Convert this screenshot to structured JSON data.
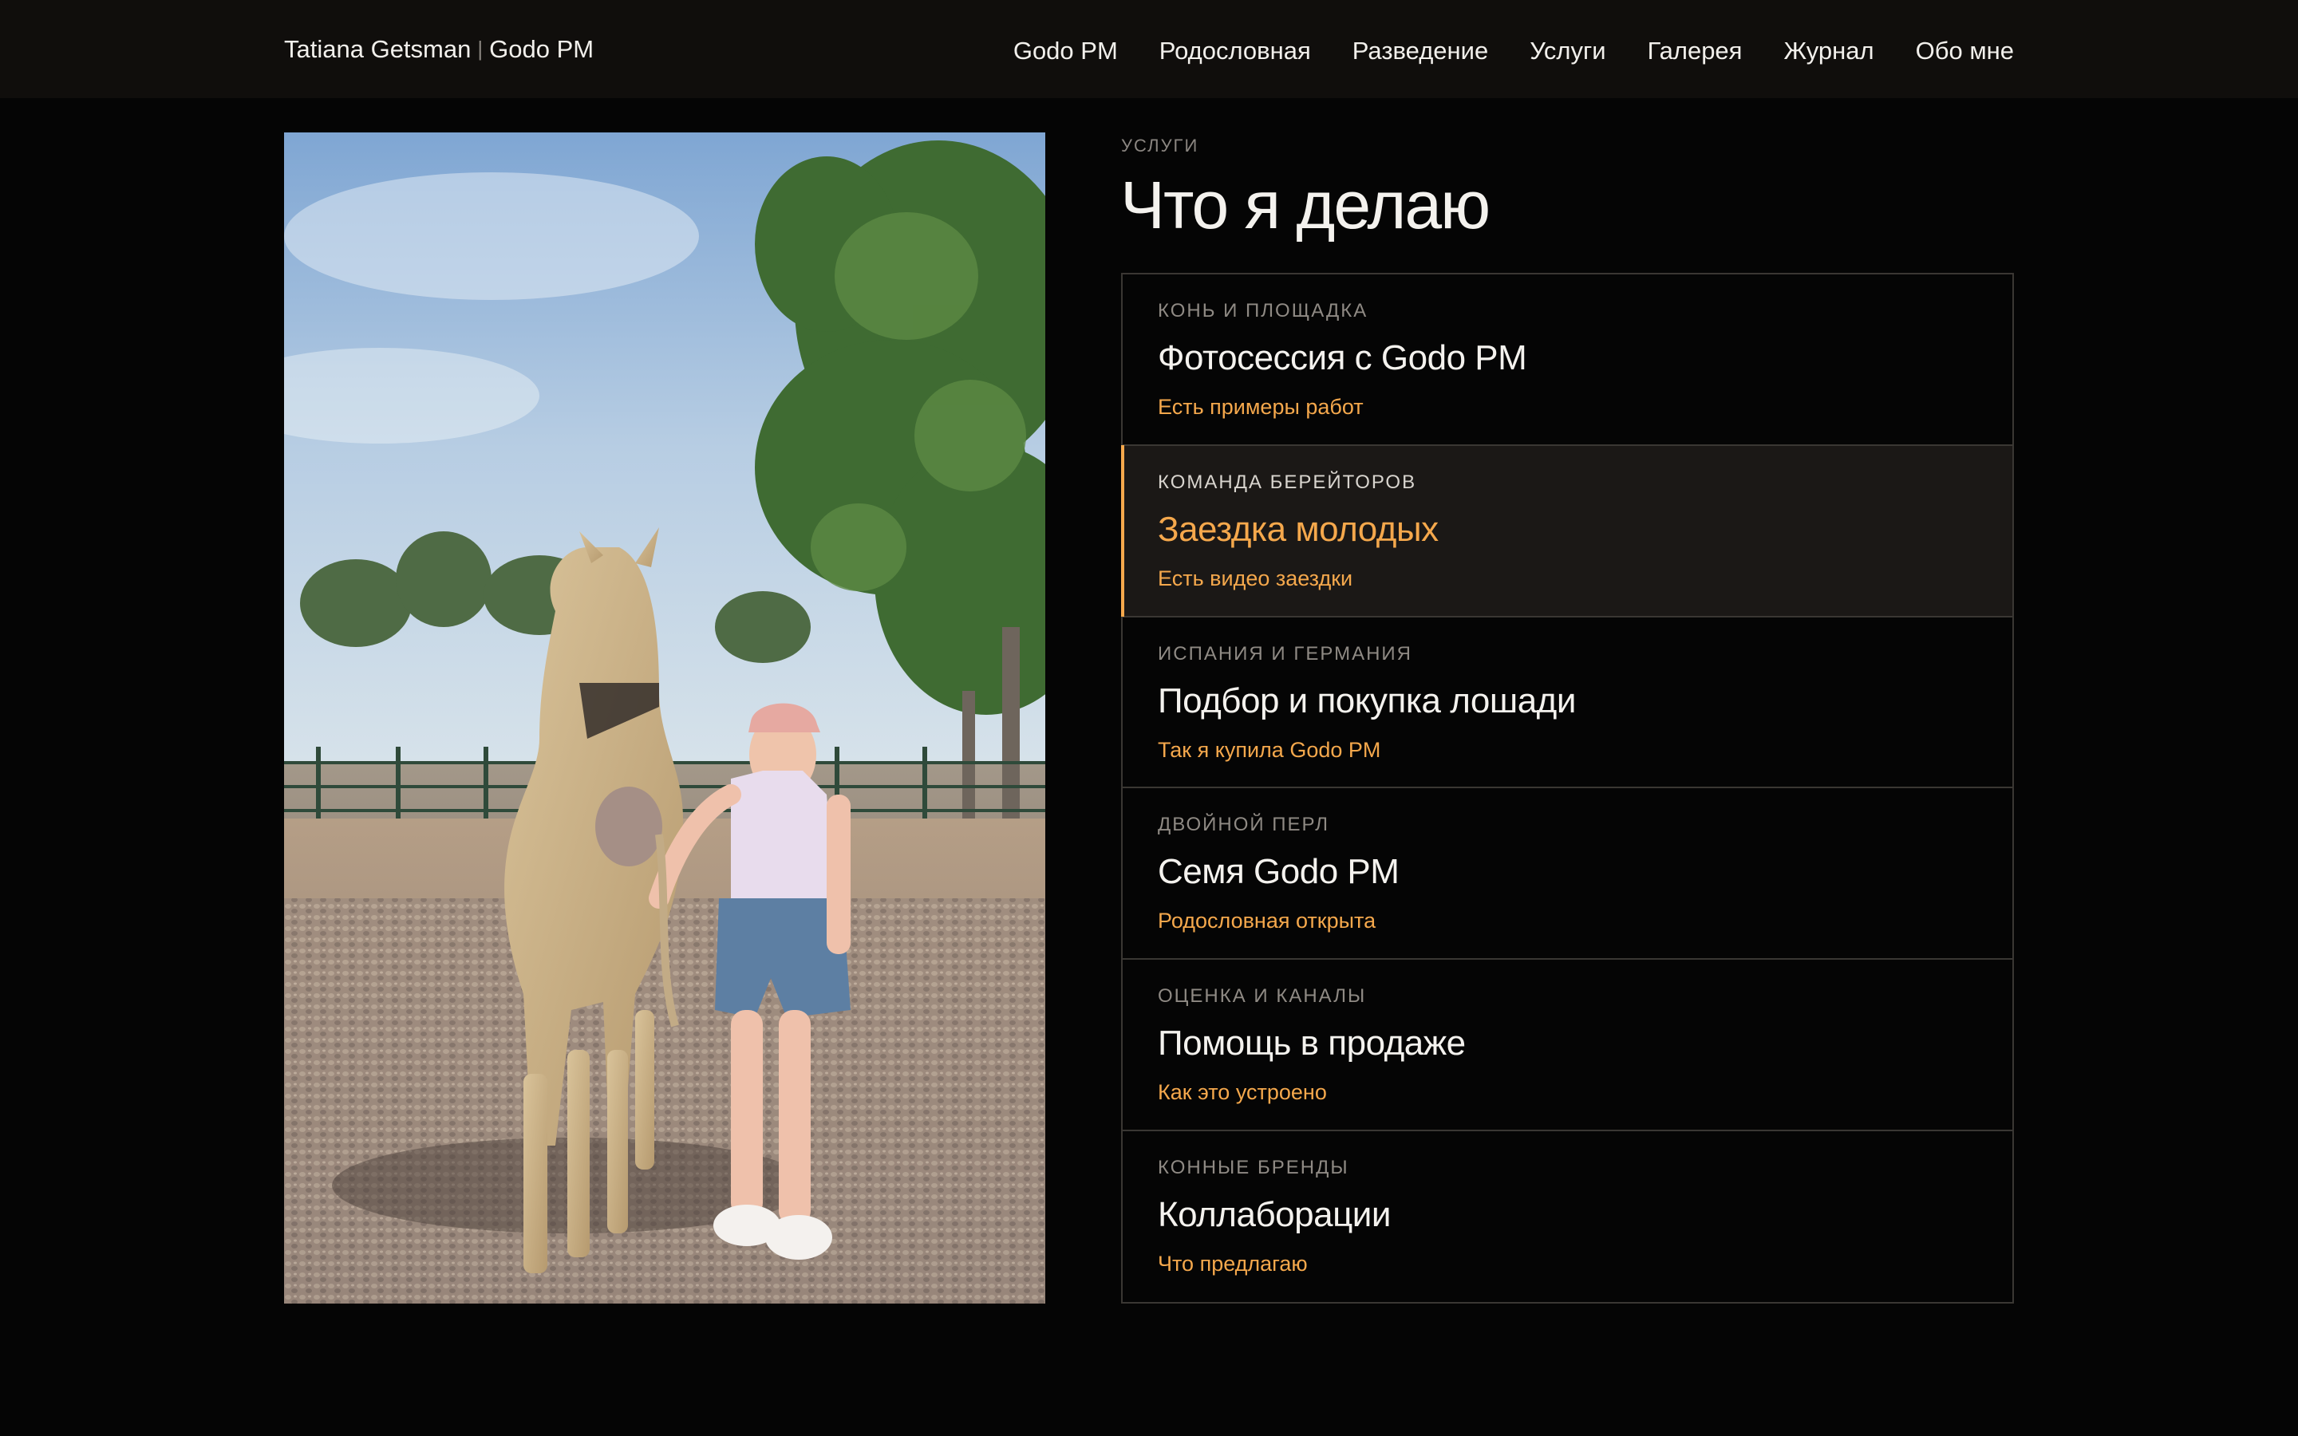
{
  "header": {
    "brand_name": "Tatiana Getsman",
    "brand_separator": "|",
    "brand_product": "Godo PM",
    "nav": [
      "Godo PM",
      "Родословная",
      "Разведение",
      "Услуги",
      "Галерея",
      "Журнал",
      "Обо мне"
    ]
  },
  "section": {
    "eyebrow": "УСЛУГИ",
    "title": "Что я делаю"
  },
  "services": [
    {
      "kicker": "КОНЬ И ПЛОЩАДКА",
      "name": "Фотосессия с Godo PM",
      "link": "Есть примеры работ"
    },
    {
      "kicker": "КОМАНДА БЕРЕЙТОРОВ",
      "name": "Заездка молодых",
      "link": "Есть видео заездки"
    },
    {
      "kicker": "ИСПАНИЯ И ГЕРМАНИЯ",
      "name": "Подбор и покупка лошади",
      "link": "Так я купила Godo PM"
    },
    {
      "kicker": "ДВОЙНОЙ ПЕРЛ",
      "name": "Семя Godo PM",
      "link": "Родословная открыта"
    },
    {
      "kicker": "ОЦЕНКА И КАНАЛЫ",
      "name": "Помощь в продаже",
      "link": "Как это устроено"
    },
    {
      "kicker": "КОННЫЕ БРЕНДЫ",
      "name": "Коллаборации",
      "link": "Что предлагаю"
    }
  ],
  "active_service_index": 1,
  "colors": {
    "accent": "#f5a84c",
    "background": "#050505",
    "header_background": "#100e0c",
    "active_row_background": "#1b1816",
    "border": "#3a3733"
  }
}
